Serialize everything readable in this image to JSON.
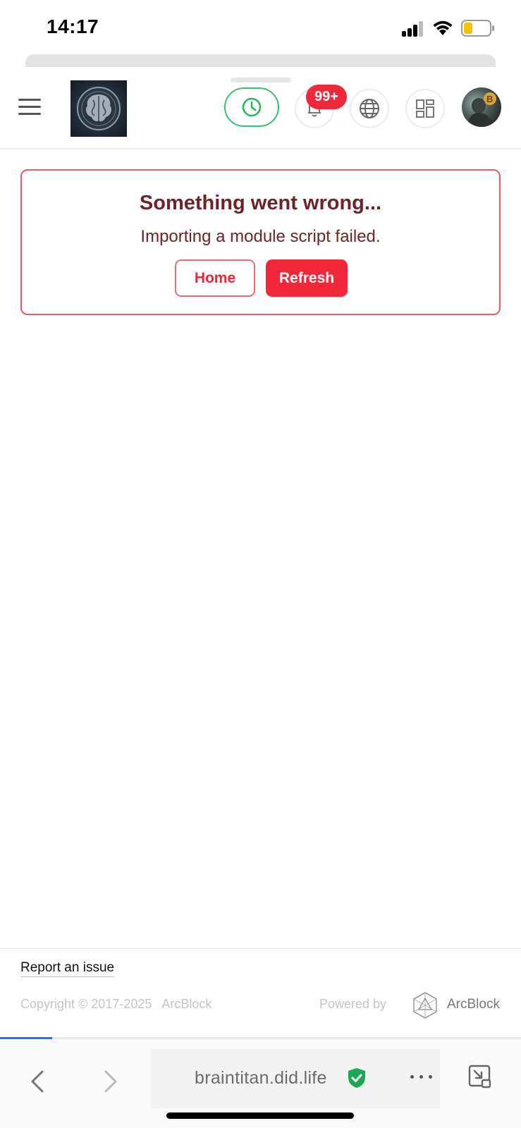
{
  "status_bar": {
    "time": "14:17"
  },
  "header": {
    "menu_icon": "hamburger-menu-icon",
    "logo_icon": "brain-logo-icon",
    "clock_icon": "clock-icon",
    "notification_icon": "bell-icon",
    "notification_count": "99+",
    "language_icon": "globe-icon",
    "apps_icon": "grid-apps-icon",
    "avatar_icon": "user-avatar"
  },
  "error": {
    "title": "Something went wrong...",
    "message": "Importing a module script failed.",
    "home_label": "Home",
    "refresh_label": "Refresh"
  },
  "footer": {
    "report_label": "Report an issue",
    "copyright": "Copyright © 2017-2025",
    "copyright_brand": "ArcBlock",
    "powered_by": "Powered by",
    "arcblock_name": "ArcBlock"
  },
  "browser": {
    "url": "braintitan.did.life",
    "load_progress": 0.1,
    "secure_icon": "shield-check-icon"
  },
  "colors": {
    "accent_red": "#f2283a",
    "clock_green": "#3cc070",
    "error_text": "#6e2328",
    "progress_blue": "#1e78e6",
    "secure_green": "#1aa854"
  }
}
